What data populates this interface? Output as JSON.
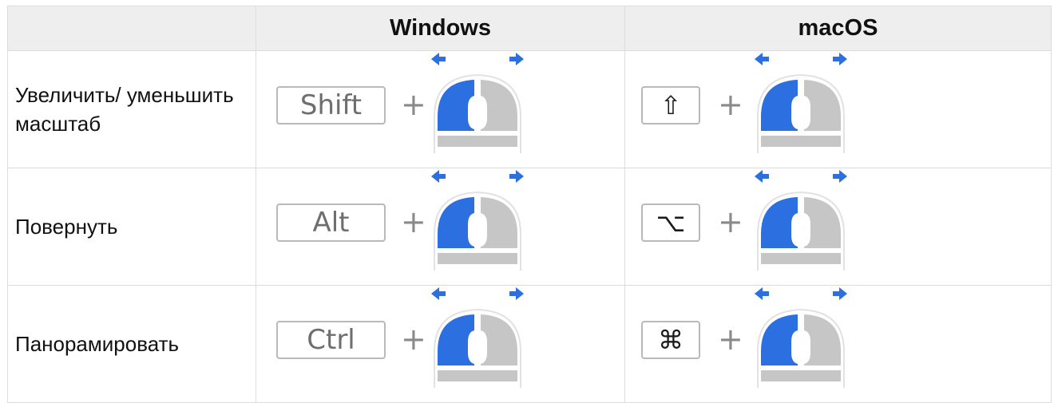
{
  "header": {
    "action_col": "",
    "windows": "Windows",
    "macos": "macOS"
  },
  "rows": [
    {
      "action": "Увеличить/ уменьшить масштаб",
      "windows_key": "Shift",
      "mac_key_icon": "shift-arrow-icon",
      "mac_key_glyph": "⇧",
      "plus": "+",
      "mouse_icon": "mouse-left-drag-icon"
    },
    {
      "action": "Повернуть",
      "windows_key": "Alt",
      "mac_key_icon": "option-key-icon",
      "mac_key_glyph": "⌥",
      "plus": "+",
      "mouse_icon": "mouse-left-drag-icon"
    },
    {
      "action": "Панорамировать",
      "windows_key": "Ctrl",
      "mac_key_icon": "command-key-icon",
      "mac_key_glyph": "⌘",
      "plus": "+",
      "mouse_icon": "mouse-left-drag-icon"
    }
  ],
  "colors": {
    "accent_blue": "#2b6fe0",
    "mouse_gray": "#c6c6c6",
    "header_bg": "#eeeeee",
    "border": "#dcdcdc"
  }
}
